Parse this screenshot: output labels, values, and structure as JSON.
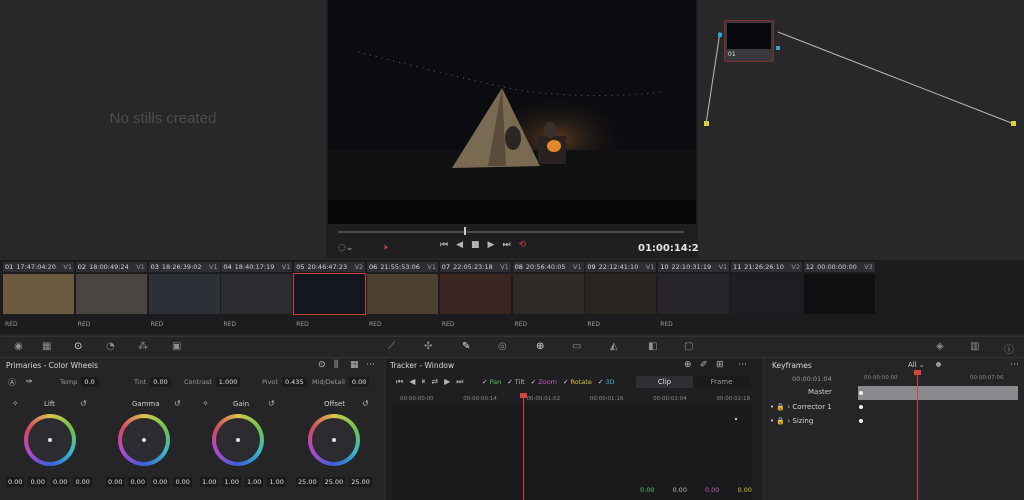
{
  "gallery": {
    "empty_text": "No stills created"
  },
  "viewer": {
    "timecode": "01:00:14:22"
  },
  "node": {
    "label": "01"
  },
  "clips": [
    {
      "num": "01",
      "tc": "17:47:04:20",
      "track": "V1",
      "codec": "RED",
      "thumb": "#6b5a3f"
    },
    {
      "num": "02",
      "tc": "18:00:49:24",
      "track": "V1",
      "codec": "RED",
      "thumb": "#4a4540"
    },
    {
      "num": "03",
      "tc": "18:26:39:02",
      "track": "V1",
      "codec": "RED",
      "thumb": "#2e3038"
    },
    {
      "num": "04",
      "tc": "18:40:17:19",
      "track": "V1",
      "codec": "RED",
      "thumb": "#2a2c30"
    },
    {
      "num": "05",
      "tc": "20:46:47:23",
      "track": "V2",
      "codec": "RED",
      "thumb": "#141720"
    },
    {
      "num": "06",
      "tc": "21:55:53:06",
      "track": "V1",
      "codec": "RED",
      "thumb": "#4c4030"
    },
    {
      "num": "07",
      "tc": "22:05:23:18",
      "track": "V1",
      "codec": "RED",
      "thumb": "#3a2520"
    },
    {
      "num": "08",
      "tc": "20:56:40:05",
      "track": "V1",
      "codec": "RED",
      "thumb": "#2d2a28"
    },
    {
      "num": "09",
      "tc": "22:12:41:10",
      "track": "V1",
      "codec": "RED",
      "thumb": "#2a2420"
    },
    {
      "num": "10",
      "tc": "22:10:31:19",
      "track": "V1",
      "codec": "RED",
      "thumb": "#262428"
    },
    {
      "num": "11",
      "tc": "21:26:26:10",
      "track": "V2",
      "codec": "",
      "thumb": "#1c1e24"
    },
    {
      "num": "12",
      "tc": "00:00:00:00",
      "track": "V3",
      "codec": "",
      "thumb": "#101012"
    }
  ],
  "primaries": {
    "title": "Primaries - Color Wheels",
    "params": [
      {
        "label": "Temp",
        "value": "0.0"
      },
      {
        "label": "Tint",
        "value": "0.00"
      },
      {
        "label": "Contrast",
        "value": "1.000"
      },
      {
        "label": "Pivot",
        "value": "0.435"
      },
      {
        "label": "Mid/Detail",
        "value": "0.00"
      }
    ],
    "wheels": [
      {
        "name": "Lift",
        "values": [
          "0.00",
          "0.00",
          "0.00",
          "0.00"
        ]
      },
      {
        "name": "Gamma",
        "values": [
          "0.00",
          "0.00",
          "0.00",
          "0.00"
        ]
      },
      {
        "name": "Gain",
        "values": [
          "1.00",
          "1.00",
          "1.00",
          "1.00"
        ]
      },
      {
        "name": "Offset",
        "values": [
          "25.00",
          "25.00",
          "25.00"
        ]
      }
    ]
  },
  "tracker": {
    "title": "Tracker - Window",
    "toggles": [
      "Pan",
      "Tilt",
      "Zoom",
      "Rotate",
      "3D"
    ],
    "tabs": [
      "Clip",
      "Frame"
    ],
    "ruler": [
      "00:00:00:00",
      "00:00:00:14",
      "00:00:01:02",
      "00:00:01:16",
      "00:00:02:04",
      "00:00:02:18"
    ],
    "readouts": [
      "0.00",
      "0.00",
      "0.00",
      "0.00"
    ]
  },
  "keyframes": {
    "title": "Keyframes",
    "filter": "All",
    "tc": "00:00:01:04",
    "ruler_start": "00:00:00:00",
    "ruler_end": "00:00:07:06",
    "rows": [
      "Master",
      "Corrector 1",
      "Sizing"
    ]
  }
}
